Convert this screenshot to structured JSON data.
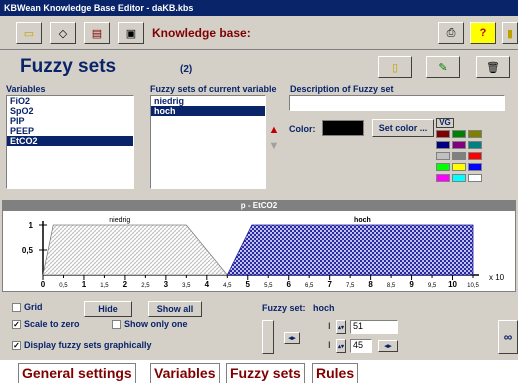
{
  "window": {
    "title": "KBWean Knowledge Base Editor - daKB.kbs"
  },
  "toolbar": {
    "kb_label": "Knowledge base:"
  },
  "header": {
    "title": "Fuzzy sets",
    "count": "(2)"
  },
  "variables": {
    "label": "Variables",
    "items": [
      "FiO2",
      "SpO2",
      "PIP",
      "PEEP",
      "EtCO2"
    ],
    "selected": 4
  },
  "fuzzy_sets": {
    "label": "Fuzzy sets of current variable",
    "items": [
      "niedrig",
      "hoch"
    ],
    "selected": 1
  },
  "description": {
    "label": "Description of Fuzzy set",
    "value": ""
  },
  "color": {
    "label": "Color:",
    "value": "#000000",
    "set_button": "Set color ...",
    "palette_label": "VG",
    "palette": [
      "#800000",
      "#008000",
      "#808000",
      "#000080",
      "#800080",
      "#008080",
      "#c0c0c0",
      "#808080",
      "#ff0000",
      "#00ff00",
      "#ffff00",
      "#0000ff",
      "#ff00ff",
      "#00ffff",
      "#ffffff"
    ]
  },
  "chart_data": {
    "type": "area",
    "title": "p - EtCO2",
    "x_unit": "x 10",
    "x_ticks": [
      "0",
      "0,5",
      "1",
      "1,5",
      "2",
      "2,5",
      "3",
      "3,5",
      "4",
      "4,5",
      "5",
      "5,5",
      "6",
      "6,5",
      "7",
      "7,5",
      "8",
      "8,5",
      "9",
      "9,5",
      "10",
      "10,5"
    ],
    "y_ticks": [
      "1",
      "0,5"
    ],
    "xlim": [
      0,
      10.5
    ],
    "ylim": [
      0,
      1
    ],
    "series": [
      {
        "name": "niedrig",
        "points": [
          [
            0,
            0
          ],
          [
            0.25,
            1
          ],
          [
            3.5,
            1
          ],
          [
            4.5,
            0
          ]
        ],
        "fill": "light-hatch"
      },
      {
        "name": "hoch",
        "points": [
          [
            4.5,
            0
          ],
          [
            5.1,
            1
          ],
          [
            10.5,
            1
          ],
          [
            10.5,
            0
          ]
        ],
        "fill": "blue-crosshatch"
      }
    ]
  },
  "controls": {
    "grid": "Grid",
    "hide": "Hide",
    "show_all": "Show all",
    "scale_to_zero": "Scale to zero",
    "show_only_one": "Show only one",
    "display_graphically": "Display fuzzy sets graphically",
    "fuzzy_set_label": "Fuzzy set:",
    "fuzzy_set_name": "hoch",
    "value1": "51",
    "value2": "45",
    "infinity": "∞"
  },
  "tabs": [
    "General settings",
    "Variables",
    "Fuzzy sets",
    "Rules"
  ]
}
